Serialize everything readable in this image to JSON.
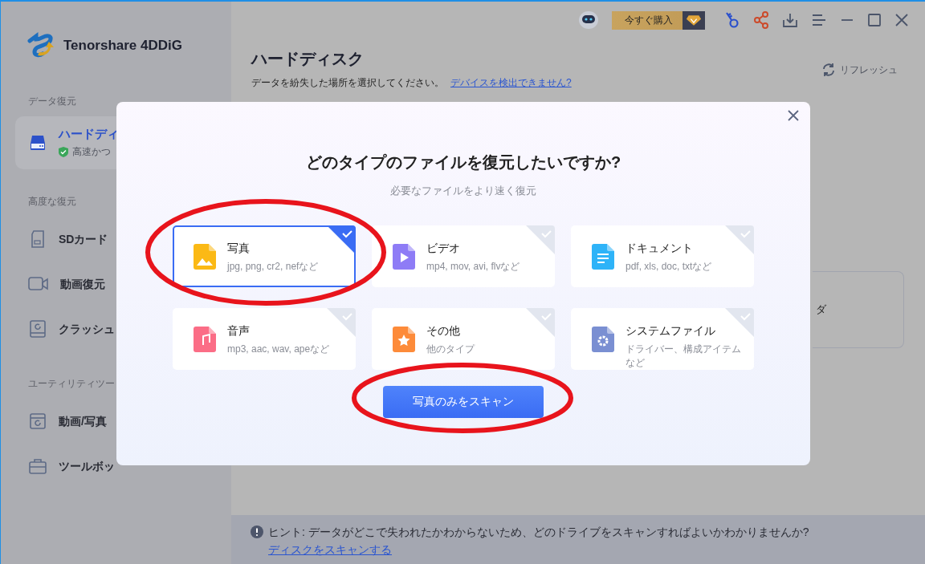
{
  "app": {
    "name": "Tenorshare 4DDiG"
  },
  "toolbar": {
    "buy_label": "今すぐ購入"
  },
  "sidebar": {
    "sections": [
      {
        "heading": "データ復元",
        "items": [
          {
            "label": "ハードディ",
            "sub": "高速かつ",
            "selected": true
          }
        ]
      },
      {
        "heading": "高度な復元",
        "items": [
          {
            "label": "SDカード",
            "selected": false
          },
          {
            "label": "動画復元",
            "selected": false
          },
          {
            "label": "クラッシュ",
            "selected": false
          }
        ]
      },
      {
        "heading": "ユーティリティツー",
        "items": [
          {
            "label": "動画/写真",
            "selected": false
          },
          {
            "label": "ツールボッ",
            "selected": false
          }
        ]
      }
    ]
  },
  "main": {
    "title": "ハードディスク",
    "description": "データを紛失した場所を選択してください。",
    "link": "デバイスを検出できません?",
    "refresh": "リフレッシュ",
    "card_text": "ダ"
  },
  "dialog": {
    "title": "どのタイプのファイルを復元したいですか?",
    "subtitle": "必要なファイルをより速く復元",
    "types": [
      {
        "title": "写真",
        "description": "jpg, png, cr2, nefなど",
        "selected": true
      },
      {
        "title": "ビデオ",
        "description": "mp4, mov, avi, flvなど",
        "selected": false
      },
      {
        "title": "ドキュメント",
        "description": "pdf, xls, doc, txtなど",
        "selected": false
      },
      {
        "title": "音声",
        "description": "mp3, aac, wav, apeなど",
        "selected": false
      },
      {
        "title": "その他",
        "description": "他のタイプ",
        "selected": false
      },
      {
        "title": "システムファイル",
        "description": "ドライバー、構成アイテムなど",
        "selected": false
      }
    ],
    "button": "写真のみをスキャン"
  },
  "hint": {
    "label": "ヒント:",
    "text": "データがどこで失われたかわからないため、どのドライブをスキャンすればよいかわかりませんか?",
    "link": "ディスクをスキャンする"
  }
}
